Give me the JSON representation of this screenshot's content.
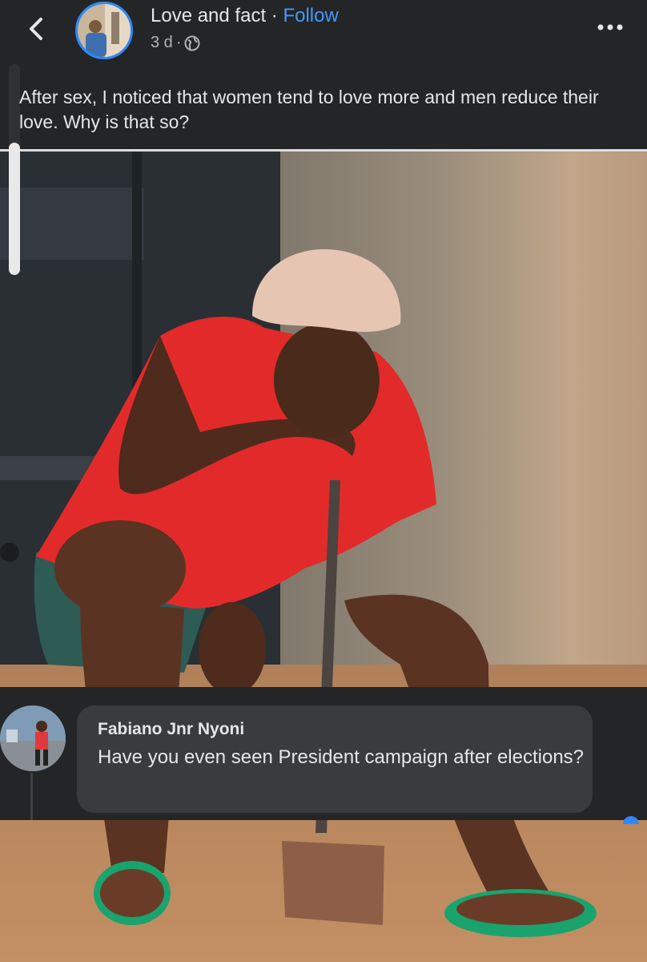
{
  "post": {
    "page_name": "Love and fact",
    "separator": " · ",
    "follow_label": "Follow",
    "age": "3 d",
    "meta_dot": "·",
    "text": "After sex, I noticed that women tend to love more and men reduce their love. Why is that so?",
    "icons": {
      "back": "chevron-left-icon",
      "privacy": "globe-icon",
      "more": "more-options-icon"
    }
  },
  "comment": {
    "author": "Fabiano Jnr Nyoni",
    "text": "Have you even seen President campaign after elections?"
  },
  "colors": {
    "accent": "#2d88ff",
    "follow": "#4599ff",
    "background": "#242526",
    "bubble": "#3a3b3c"
  }
}
